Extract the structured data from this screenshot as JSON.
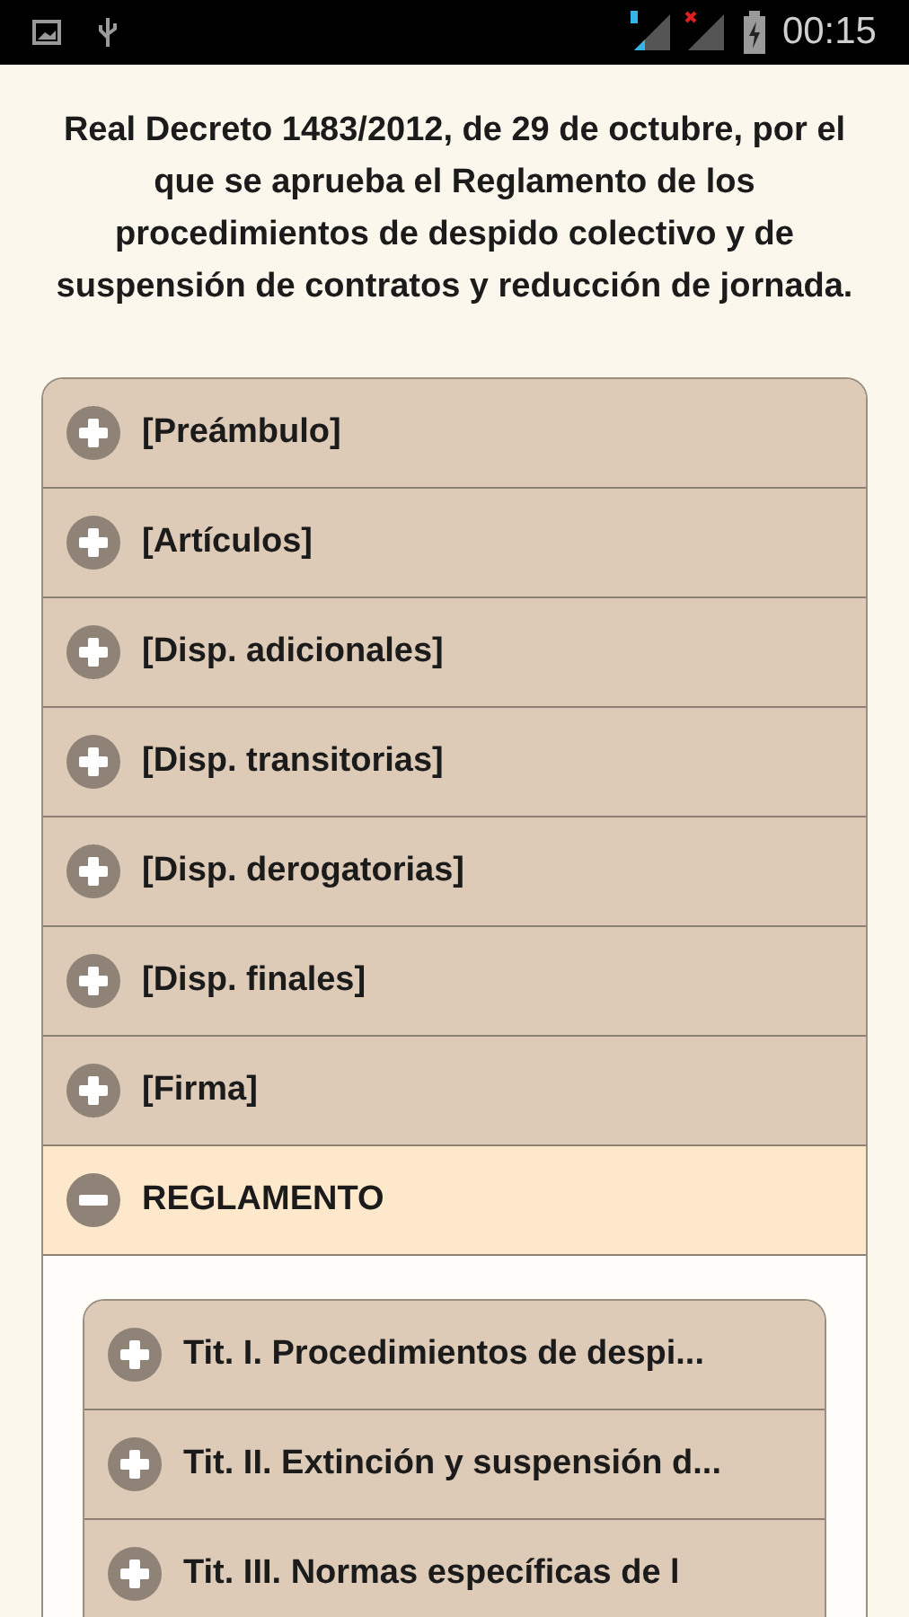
{
  "status_bar": {
    "time": "00:15"
  },
  "title": "Real Decreto 1483/2012, de 29 de octubre, por el que se aprueba el Reglamento de los procedimientos de despido colectivo y de suspensión de contratos y reducción de jornada.",
  "sections": [
    {
      "label": "[Preámbulo]",
      "expanded": false
    },
    {
      "label": "[Artículos]",
      "expanded": false
    },
    {
      "label": "[Disp. adicionales]",
      "expanded": false
    },
    {
      "label": "[Disp. transitorias]",
      "expanded": false
    },
    {
      "label": "[Disp. derogatorias]",
      "expanded": false
    },
    {
      "label": "[Disp. finales]",
      "expanded": false
    },
    {
      "label": "[Firma]",
      "expanded": false
    },
    {
      "label": "REGLAMENTO",
      "expanded": true,
      "children": [
        {
          "label": "Tit. I. Procedimientos de despi...",
          "expanded": false
        },
        {
          "label": "Tit. II. Extinción y suspensión d...",
          "expanded": false
        },
        {
          "label": "Tit. III. Normas específicas de l",
          "expanded": false
        }
      ]
    }
  ]
}
